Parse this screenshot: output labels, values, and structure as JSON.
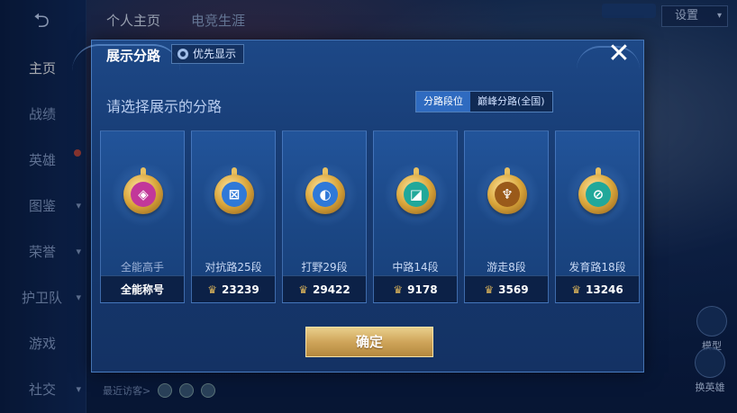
{
  "background": {
    "nav_items": [
      {
        "label": "主页",
        "active": true
      },
      {
        "label": "战绩"
      },
      {
        "label": "英雄"
      },
      {
        "label": "图鉴"
      },
      {
        "label": "荣誉"
      },
      {
        "label": "护卫队"
      },
      {
        "label": "游戏"
      },
      {
        "label": "社交"
      }
    ],
    "top_tabs": [
      "个人主页",
      "电竞生涯"
    ],
    "settings_label": "设置",
    "recent_visitors_label": "最近访客>",
    "right_buttons": [
      "模型",
      "换英雄"
    ]
  },
  "modal": {
    "title": "展示分路",
    "priority_label": "优先显示",
    "close_symbol": "✕",
    "subtitle": "请选择展示的分路",
    "tabs": [
      {
        "label": "分路段位",
        "active": true
      },
      {
        "label": "巅峰分路(全国)",
        "active": false
      }
    ],
    "cards": [
      {
        "label": "全能高手",
        "footer": "全能称号",
        "emblem": "all-round-emblem-icon",
        "core_color": "#c2379a",
        "glyph": "◈"
      },
      {
        "label": "对抗路25段",
        "footer": "23239",
        "emblem": "clash-lane-emblem-icon",
        "core_color": "#2f79d8",
        "glyph": "⊠"
      },
      {
        "label": "打野29段",
        "footer": "29422",
        "emblem": "jungle-emblem-icon",
        "core_color": "#2f79d8",
        "glyph": "◐"
      },
      {
        "label": "中路14段",
        "footer": "9178",
        "emblem": "mid-lane-emblem-icon",
        "core_color": "#21a89a",
        "glyph": "◪"
      },
      {
        "label": "游走8段",
        "footer": "3569",
        "emblem": "roam-emblem-icon",
        "core_color": "#9a5a1a",
        "glyph": "♆"
      },
      {
        "label": "发育路18段",
        "footer": "13246",
        "emblem": "farm-lane-emblem-icon",
        "core_color": "#21a89a",
        "glyph": "⊘"
      }
    ],
    "confirm_label": "确定"
  }
}
